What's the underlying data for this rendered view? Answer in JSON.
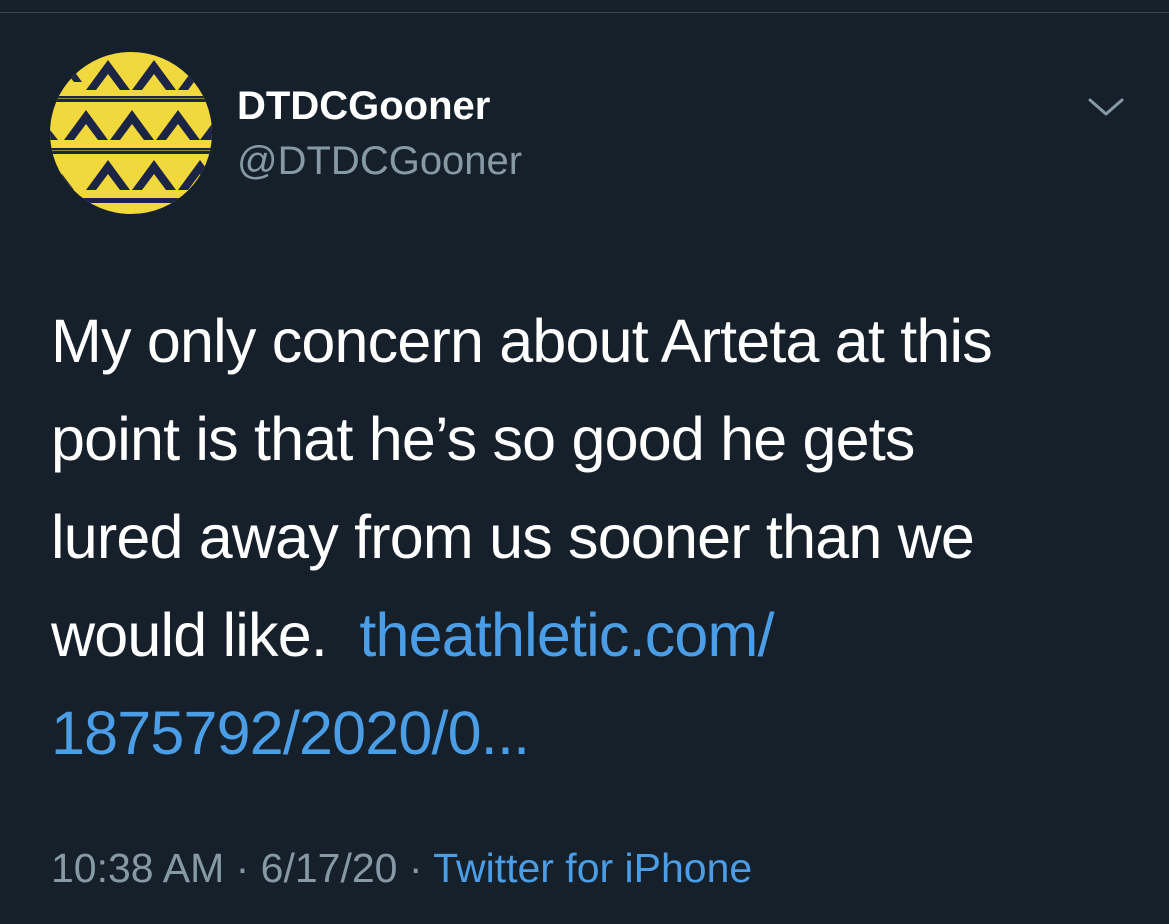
{
  "tweet": {
    "author": {
      "display_name": "DTDCGooner",
      "handle": "@DTDCGooner",
      "avatar_icon": "yellow-navy-zigzag-avatar"
    },
    "menu_icon": "chevron-down-icon",
    "text_lines": [
      "My only concern about Arteta at this",
      "point is that he’s so good he gets",
      "lured away from us sooner than we",
      "would like."
    ],
    "link_lines": [
      "theathletic.com/",
      "1875792/2020/0..."
    ],
    "time": "10:38 AM",
    "separator": " · ",
    "date": "6/17/20",
    "source": "Twitter for iPhone"
  },
  "colors": {
    "background": "#15202b",
    "text": "#ffffff",
    "secondary_text": "#8899a6",
    "link": "#4b9de6",
    "avatar_yellow": "#f1d83c",
    "avatar_navy": "#1d2546"
  }
}
